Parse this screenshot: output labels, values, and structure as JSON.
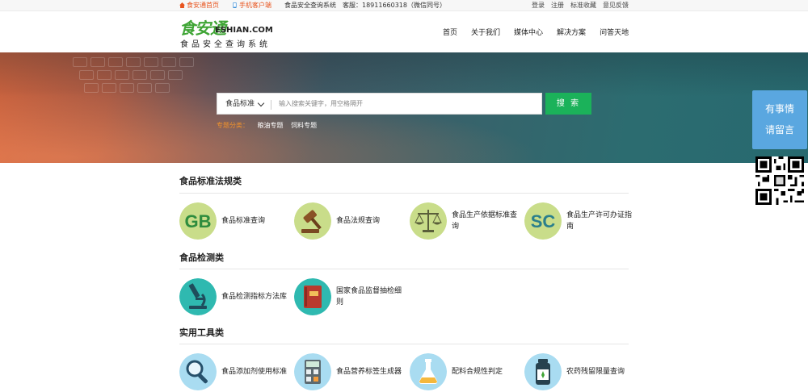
{
  "topbar": {
    "home": "食安通首页",
    "mobile": "手机客户端",
    "system": "食品安全查询系统",
    "service": "客服：18911660318（微信同号）",
    "links": [
      "登录",
      "注册",
      "标准收藏",
      "意见反馈"
    ]
  },
  "logo": {
    "main": "食安通",
    "en": "ESHIAN.COM",
    "sub": "食品安全查询系统"
  },
  "nav": [
    "首页",
    "关于我们",
    "媒体中心",
    "解决方案",
    "问答天地"
  ],
  "search": {
    "category": "食品标准",
    "placeholder": "输入搜索关键字，用空格隔开",
    "button": "搜 索",
    "topics_label": "专题分类：",
    "topics": [
      "粮油专题",
      "饲料专题"
    ]
  },
  "sections": [
    {
      "title": "食品标准法规类",
      "items": [
        {
          "label": "食品标准查询",
          "icon": "gb-icon"
        },
        {
          "label": "食品法规查询",
          "icon": "gavel-icon"
        },
        {
          "label": "食品生产依据标准查询",
          "icon": "scale-icon"
        },
        {
          "label": "食品生产许可办证指南",
          "icon": "sc-icon"
        }
      ]
    },
    {
      "title": "食品检测类",
      "items": [
        {
          "label": "食品检测指标方法库",
          "icon": "microscope-icon"
        },
        {
          "label": "国家食品监督抽检细则",
          "icon": "book-icon"
        }
      ]
    },
    {
      "title": "实用工具类",
      "items": [
        {
          "label": "食品添加剂使用标准",
          "icon": "magnifier-icon"
        },
        {
          "label": "食品营养标签生成器",
          "icon": "calculator-icon"
        },
        {
          "label": "配料合规性判定",
          "icon": "flask-icon"
        },
        {
          "label": "农药残留限量查询",
          "icon": "bottle-icon"
        }
      ]
    }
  ],
  "float": {
    "line1": "有事情",
    "line2": "请留言"
  },
  "colors": {
    "brand_green": "#3fa535",
    "search_button": "#1bb25a",
    "accent_orange": "#e8541e",
    "topic_label": "#f0922c",
    "float_blue": "#5aa7e0"
  }
}
